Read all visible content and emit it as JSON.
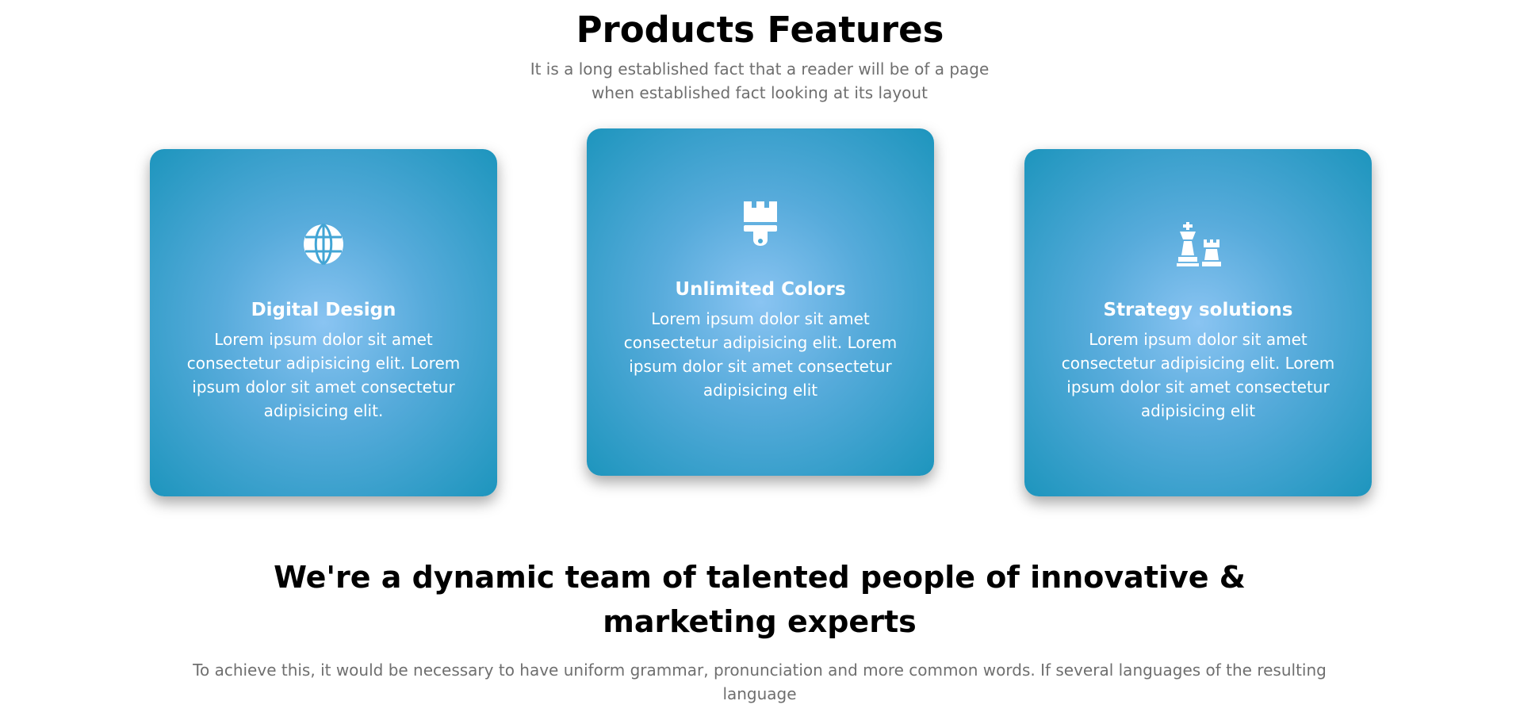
{
  "features": {
    "title": "Products Features",
    "subtitle": "It is a long established fact that a reader will be of a page when established fact looking at its layout",
    "cards": [
      {
        "icon": "globe-icon",
        "title": "Digital Design",
        "text": "Lorem ipsum dolor sit amet consectetur adipisicing elit. Lorem ipsum dolor sit amet consectetur adipisicing elit."
      },
      {
        "icon": "paint-brush-icon",
        "title": "Unlimited Colors",
        "text": "Lorem ipsum dolor sit amet consectetur adipisicing elit. Lorem ipsum dolor sit amet consectetur adipisicing elit"
      },
      {
        "icon": "chess-icon",
        "title": "Strategy solutions",
        "text": "Lorem ipsum dolor sit amet consectetur adipisicing elit. Lorem ipsum dolor sit amet consectetur adipisicing elit"
      }
    ],
    "colors": {
      "card_center": "#8ac4f2",
      "card_edge": "#1d95bd",
      "heading": "#000000",
      "muted_text": "#6f6f6f"
    }
  },
  "team": {
    "heading": "We're a dynamic team of talented people of innovative & marketing experts",
    "text": "To achieve this, it would be necessary to have uniform grammar, pronunciation and more common words. If several languages of the resulting language"
  }
}
